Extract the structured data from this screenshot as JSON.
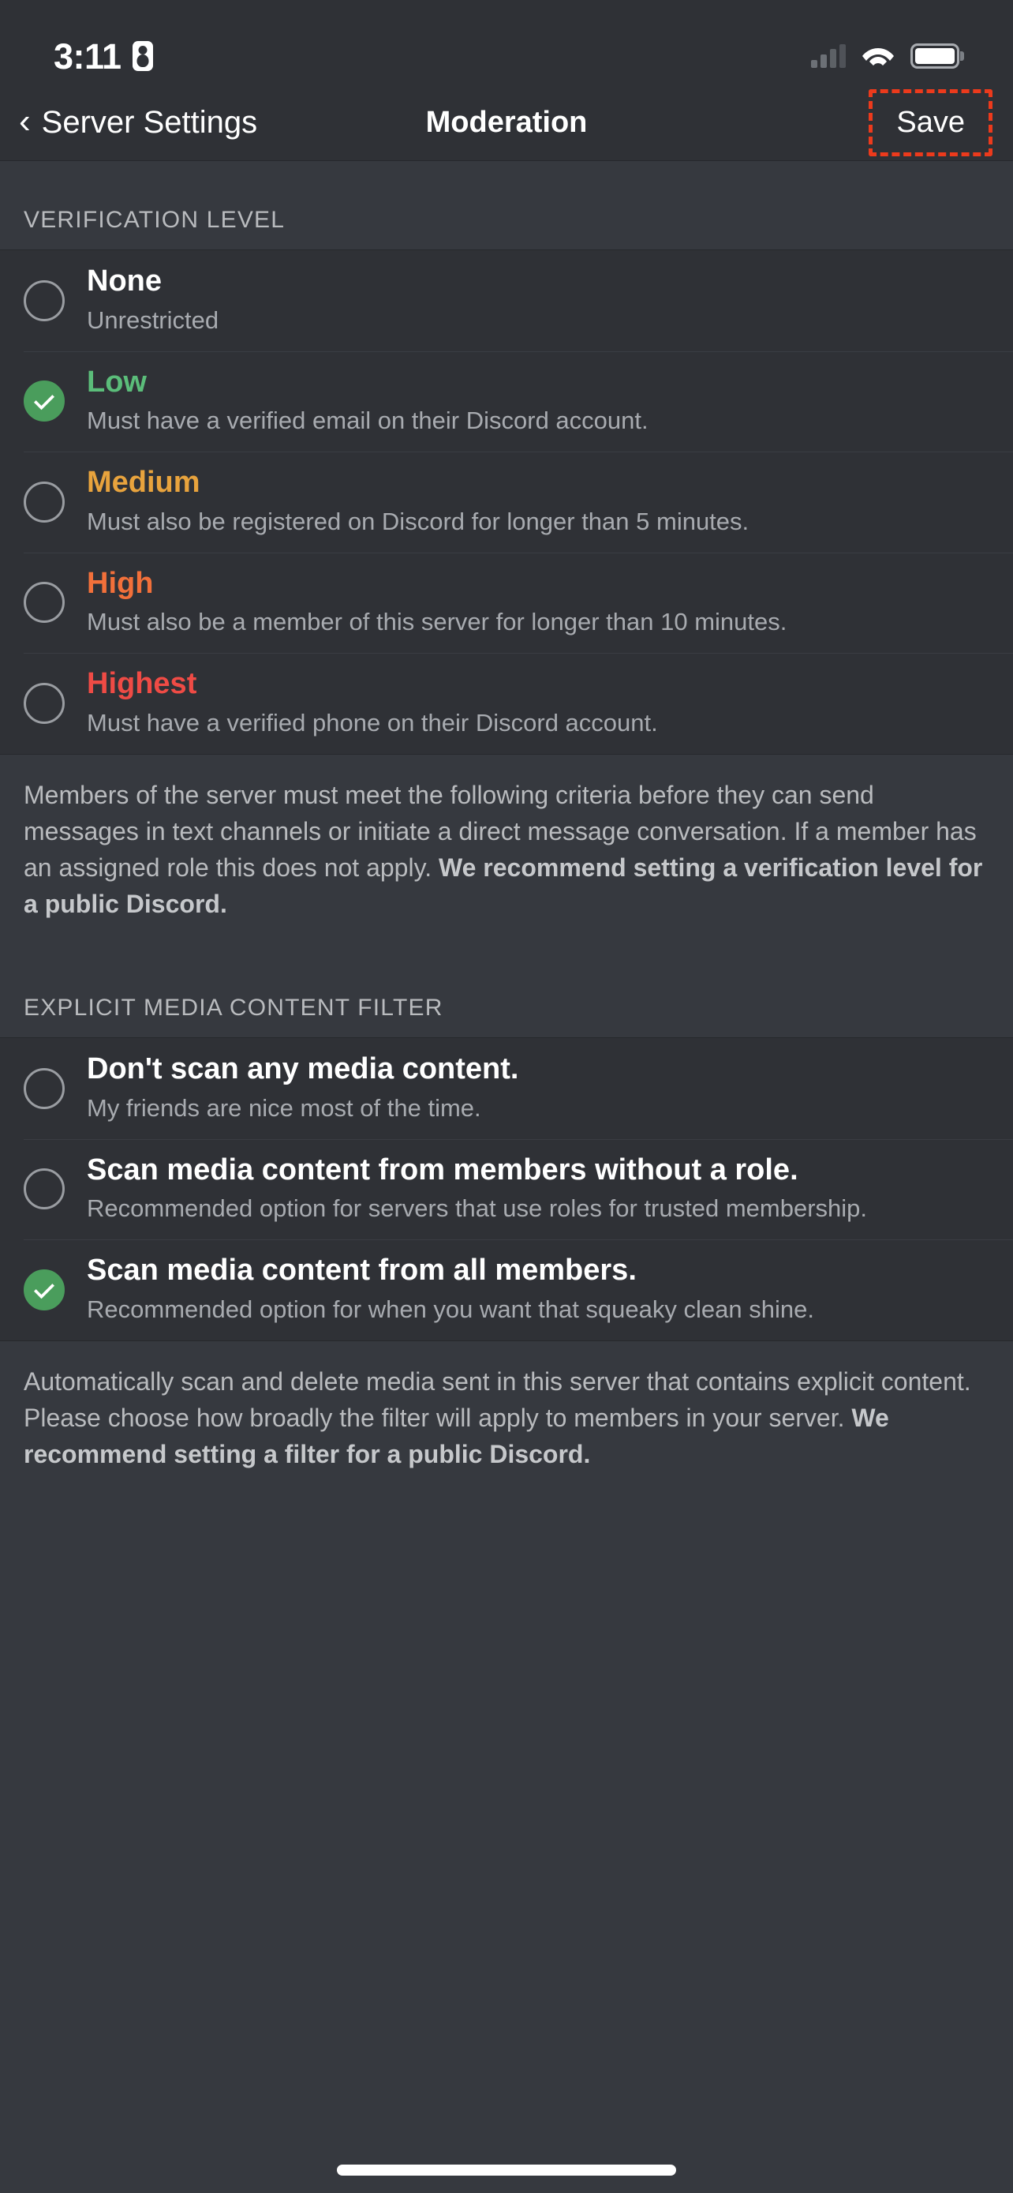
{
  "status_bar": {
    "time": "3:11",
    "recording_icon": "screen-record-icon",
    "signal_icon": "cellular-signal-icon",
    "wifi_icon": "wifi-icon",
    "battery_icon": "battery-icon"
  },
  "nav": {
    "back_label": "Server Settings",
    "back_icon": "chevron-left-icon",
    "title": "Moderation",
    "save_label": "Save",
    "highlight_color": "#ec3a1c"
  },
  "verification": {
    "header": "VERIFICATION LEVEL",
    "options": [
      {
        "title": "None",
        "desc": "Unrestricted",
        "selected": false,
        "color": "#ffffff",
        "class": "lvl-none"
      },
      {
        "title": "Low",
        "desc": "Must have a verified email on their Discord account.",
        "selected": true,
        "color": "#5bbd7a",
        "class": "lvl-low"
      },
      {
        "title": "Medium",
        "desc": "Must also be registered on Discord for longer than 5 minutes.",
        "selected": false,
        "color": "#e8a33d",
        "class": "lvl-medium"
      },
      {
        "title": "High",
        "desc": "Must also be a member of this server for longer than 10 minutes.",
        "selected": false,
        "color": "#f2703a",
        "class": "lvl-high"
      },
      {
        "title": "Highest",
        "desc": "Must have a verified phone on their Discord account.",
        "selected": false,
        "color": "#ef4b45",
        "class": "lvl-highest"
      }
    ],
    "note_plain": "Members of the server must meet the following criteria before they can send messages in text channels or initiate a direct message conversation. If a member has an assigned role this does not apply. ",
    "note_bold": "We recommend setting a verification level for a public Discord."
  },
  "media_filter": {
    "header": "EXPLICIT MEDIA CONTENT FILTER",
    "options": [
      {
        "title": "Don't scan any media content.",
        "desc": "My friends are nice most of the time.",
        "selected": false
      },
      {
        "title": "Scan media content from members without a role.",
        "desc": "Recommended option for servers that use roles for trusted membership.",
        "selected": false
      },
      {
        "title": "Scan media content from all members.",
        "desc": "Recommended option for when you want that squeaky clean shine.",
        "selected": true
      }
    ],
    "note_plain": "Automatically scan and delete media sent in this server that contains explicit content. Please choose how broadly the filter will apply to members in your server. ",
    "note_bold": "We recommend setting a filter for a public Discord."
  },
  "theme": {
    "bg_row": "#2f3136",
    "bg_panel": "#36393f",
    "accent_green": "#4a9d5c",
    "text_primary": "#ffffff",
    "text_secondary": "#a8abb0"
  }
}
